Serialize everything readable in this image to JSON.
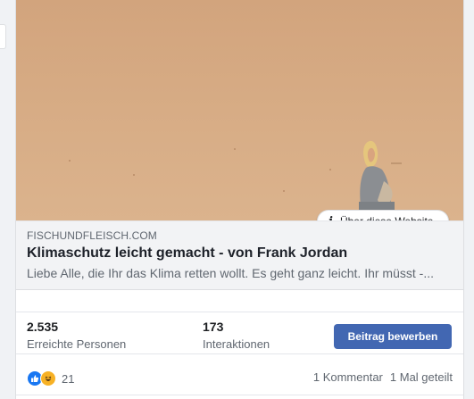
{
  "link_preview": {
    "image_alt": "",
    "about_label": "Über diese Website",
    "domain": "FISCHUNDFLEISCH.COM",
    "title": "Klimaschutz leicht gemacht - von Frank Jordan",
    "description": "Liebe Alle, die Ihr das Klima retten wollt. Es geht ganz leicht. Ihr müsst -..."
  },
  "insights": {
    "reach_value": "2.535",
    "reach_label": "Erreichte Personen",
    "engagement_value": "173",
    "engagement_label": "Interaktionen",
    "boost_label": "Beitrag bewerben"
  },
  "reactions": {
    "icons": [
      "like-icon",
      "haha-icon"
    ],
    "count": "21",
    "comments": "1 Kommentar",
    "shares": "1 Mal geteilt"
  },
  "colors": {
    "accent": "#4267b2",
    "like": "#1877f2",
    "haha": "#f7b125",
    "meta_bg": "#f2f3f5",
    "sand": "#d8ae87"
  }
}
